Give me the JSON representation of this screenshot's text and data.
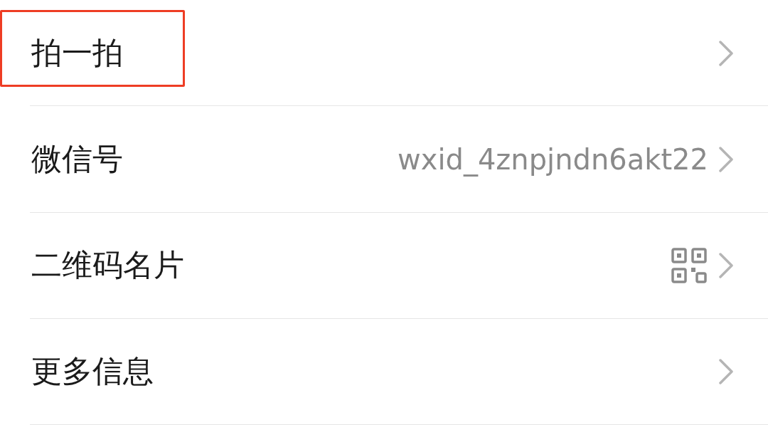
{
  "items": [
    {
      "kind": "plain",
      "label": "拍一拍",
      "highlighted": true
    },
    {
      "kind": "value",
      "label": "微信号",
      "value": "wxid_4znpjndn6akt22",
      "highlighted": false
    },
    {
      "kind": "qr",
      "label": "二维码名片",
      "highlighted": false
    },
    {
      "kind": "plain",
      "label": "更多信息",
      "highlighted": false
    }
  ]
}
